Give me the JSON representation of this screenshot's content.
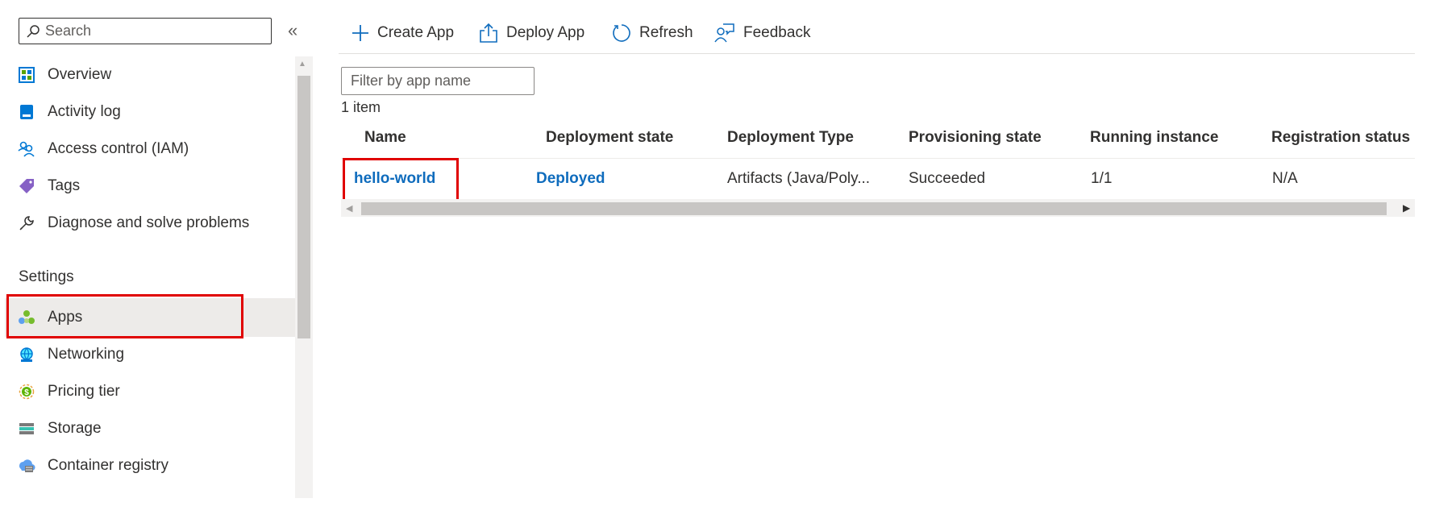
{
  "sidebar": {
    "search_placeholder": "Search",
    "collapse_glyph": "«",
    "items_top": [
      {
        "label": "Overview",
        "icon": "overview-icon"
      },
      {
        "label": "Activity log",
        "icon": "activity-log-icon"
      },
      {
        "label": "Access control (IAM)",
        "icon": "people-icon"
      },
      {
        "label": "Tags",
        "icon": "tag-icon"
      },
      {
        "label": "Diagnose and solve problems",
        "icon": "wrench-icon"
      }
    ],
    "settings_title": "Settings",
    "items_settings": [
      {
        "label": "Apps",
        "icon": "apps-icon",
        "selected": true
      },
      {
        "label": "Networking",
        "icon": "networking-icon"
      },
      {
        "label": "Pricing tier",
        "icon": "pricing-icon"
      },
      {
        "label": "Storage",
        "icon": "storage-icon"
      },
      {
        "label": "Container registry",
        "icon": "container-registry-icon"
      }
    ]
  },
  "toolbar": {
    "create_label": "Create App",
    "deploy_label": "Deploy App",
    "refresh_label": "Refresh",
    "feedback_label": "Feedback"
  },
  "main": {
    "filter_placeholder": "Filter by app name",
    "count_text": "1 item",
    "columns": [
      "Name",
      "Deployment state",
      "Deployment Type",
      "Provisioning state",
      "Running instance",
      "Registration status"
    ],
    "rows": [
      {
        "name": "hello-world",
        "deployment_state": "Deployed",
        "deployment_type": "Artifacts (Java/Poly...",
        "provisioning_state": "Succeeded",
        "running_instance": "1/1",
        "registration_status": "N/A"
      }
    ]
  },
  "colors": {
    "link": "#0f6cbd",
    "highlight_box": "#e00000",
    "selected_bg": "#edebe9",
    "toolbar_icon": "#0f6cbd"
  }
}
